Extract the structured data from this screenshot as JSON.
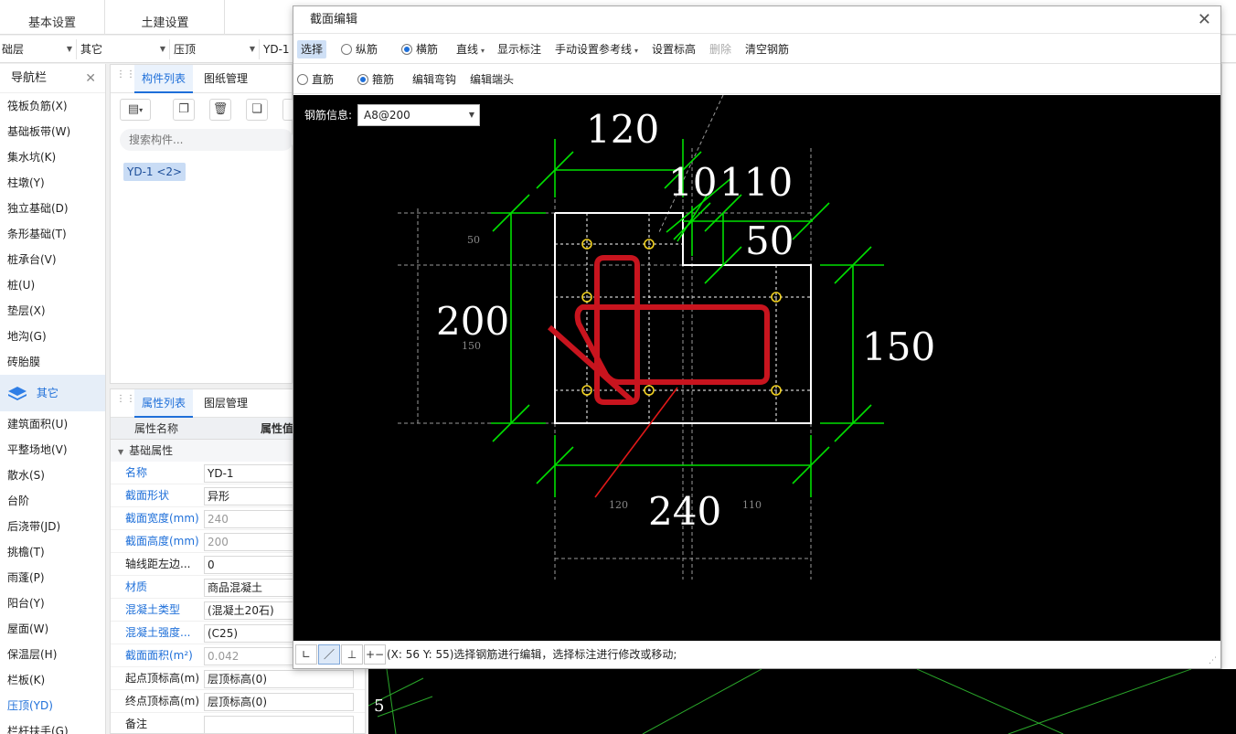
{
  "top_tabs": [
    "基本设置",
    "土建设置"
  ],
  "dropdowns": [
    "础层",
    "其它",
    "压顶",
    "YD-1"
  ],
  "nav": {
    "title": "导航栏",
    "items_before": [
      "筏板负筋(X)",
      "基础板带(W)",
      "集水坑(K)",
      "柱墩(Y)",
      "独立基础(D)",
      "条形基础(T)",
      "桩承台(V)",
      "桩(U)",
      "垫层(X)",
      "地沟(G)",
      "砖胎膜"
    ],
    "category": "其它",
    "items_after": [
      "建筑面积(U)",
      "平整场地(V)",
      "散水(S)",
      "台阶",
      "后浇带(JD)",
      "挑檐(T)",
      "雨蓬(P)",
      "阳台(Y)",
      "屋面(W)",
      "保温层(H)",
      "栏板(K)",
      "压顶(YD)",
      "栏杆扶手(G)"
    ],
    "active_item": "压顶(YD)"
  },
  "component_panel": {
    "tabs": [
      "构件列表",
      "图纸管理"
    ],
    "search_placeholder": "搜索构件...",
    "selected_component": "YD-1 <2>"
  },
  "property_panel": {
    "tabs": [
      "属性列表",
      "图层管理"
    ],
    "col_name": "属性名称",
    "col_value": "属性值",
    "group": "基础属性",
    "rows": [
      {
        "name": "名称",
        "value": "YD-1",
        "blue": true
      },
      {
        "name": "截面形状",
        "value": "异形",
        "blue": true
      },
      {
        "name": "截面宽度(mm)",
        "value": "240",
        "blue": true,
        "gray": true
      },
      {
        "name": "截面高度(mm)",
        "value": "200",
        "blue": true,
        "gray": true
      },
      {
        "name": "轴线距左边...",
        "value": "0",
        "blue": false
      },
      {
        "name": "材质",
        "value": "商品混凝土",
        "blue": true
      },
      {
        "name": "混凝土类型",
        "value": "(混凝土20石)",
        "blue": true
      },
      {
        "name": "混凝土强度...",
        "value": "(C25)",
        "blue": true
      },
      {
        "name": "截面面积(m²)",
        "value": "0.042",
        "blue": true,
        "gray": true
      },
      {
        "name": "起点顶标高(m)",
        "value": "层顶标高(0)",
        "blue": false
      },
      {
        "name": "终点顶标高(m)",
        "value": "层顶标高(0)",
        "blue": false
      },
      {
        "name": "备注",
        "value": "",
        "blue": false
      }
    ]
  },
  "dialog": {
    "title": "截面编辑",
    "toolbar1": {
      "select": "选择",
      "radio_longitudinal": "纵筋",
      "radio_transverse": "横筋",
      "line": "直线",
      "show_dimensions": "显示标注",
      "manual_ref_line": "手动设置参考线",
      "set_elevation": "设置标高",
      "delete": "删除",
      "clear_rebar": "清空钢筋"
    },
    "toolbar2": {
      "radio_straight": "直筋",
      "radio_stirrup": "箍筋",
      "edit_hook": "编辑弯钩",
      "edit_end": "编辑端头"
    },
    "rebar_info_label": "钢筋信息:",
    "rebar_info_value": "A8@200",
    "dimensions": {
      "top_width": "120",
      "step_a": "10",
      "step_b": "110",
      "step_height": "50",
      "left_height": "200",
      "right_height": "150",
      "bottom_width": "240",
      "aux_top": "50",
      "aux_left": "150",
      "aux_bottom_left": "120",
      "aux_bottom_right": "110"
    },
    "status_text": "(X: 56 Y: 55)选择钢筋进行编辑，选择标注进行修改或移动;",
    "status_buttons": [
      "∟",
      "／",
      "⊥",
      "+−"
    ]
  },
  "colors": {
    "accent": "#1e6fd9",
    "dimension_green": "#00e000",
    "rebar_red": "#c8141e",
    "point_yellow": "#f0d020",
    "outline_white": "#ffffff"
  }
}
